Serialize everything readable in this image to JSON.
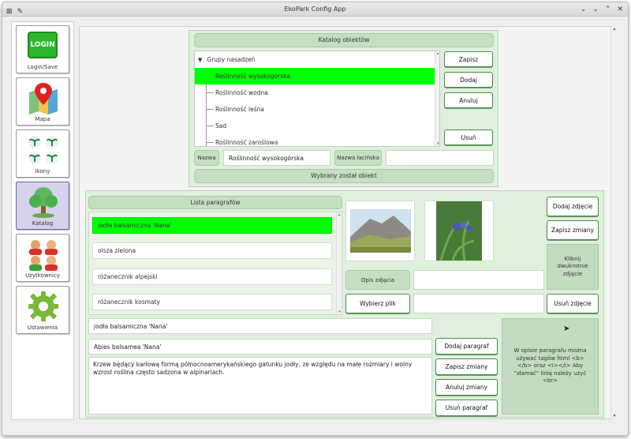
{
  "window": {
    "title": "EkoPark Config App"
  },
  "sidebar": {
    "items": [
      {
        "label": "Login/Save",
        "icon": "login-icon",
        "logo_text": "LOGIN"
      },
      {
        "label": "Mapa",
        "icon": "map-pin-icon"
      },
      {
        "label": "Ikony",
        "icon": "plant-icons-icon"
      },
      {
        "label": "Katalog",
        "icon": "tree-icon"
      },
      {
        "label": "Użytkownicy",
        "icon": "users-icon"
      },
      {
        "label": "Ustawienia",
        "icon": "gear-icon"
      }
    ],
    "active": "Katalog"
  },
  "catalog": {
    "title": "Katalog obiektów",
    "tree": {
      "root": "Grupy nasadzeń",
      "children": [
        "Roślinność wysokogórska",
        "Roślinność wodna",
        "Roślinność leśna",
        "Sad",
        "Roślinność zaroślowa"
      ],
      "selected": "Roślinność wysokogórska"
    },
    "buttons": {
      "save": "Zapisz",
      "add": "Dodaj",
      "cancel": "Anuluj",
      "delete": "Usuń"
    },
    "name_label": "Nazwa",
    "name_value": "Roślinność wysokogórska",
    "latin_label": "Nazwa łacińska",
    "latin_value": "",
    "status": "Wybrany został obiekt"
  },
  "paragraphs": {
    "title": "Lista paragrafów",
    "items": [
      "jodła balsamiczna 'Nana'",
      "olsza zielona",
      "różanecznik alpejski",
      "różanecznik kosmaty"
    ],
    "selected": "jodła balsamiczna 'Nana'",
    "photo_desc_label": "Opis zdjęcia",
    "photo_desc_value": "",
    "choose_file": "Wybierz plik",
    "file_path": "",
    "photo_buttons": {
      "add_photo": "Dodaj zdjęcie",
      "save_changes": "Zapisz zmiany",
      "delete_photo": "Usuń zdjęcie"
    },
    "dblclick_hint": "Kliknij dwukrotnie zdjęcie",
    "name_value": "jodła balsamiczna 'Nana'",
    "latin_value": "Abies balsamea 'Nana'",
    "description": "Krzew będący karłową formą północnoamerykańskiego gatunku jodły, ze względu na małe rozmiary i wolny wzrost roślina często sadzona w alpinariach.",
    "para_buttons": {
      "add": "Dodaj paragraf",
      "save": "Zapisz zmiany",
      "cancel": "Anuluj zmiany",
      "delete": "Usuń paragraf"
    },
    "html_hint": "W opisie paragrafu można używać tagów html <b></b> oraz <i></i> Aby \"złamać\" linię należy użyć <br>"
  },
  "colors": {
    "selected_green": "#00ff00",
    "panel_green": "#dff0dc",
    "header_green": "#c6dfc3",
    "button_border": "#4a8a4a",
    "active_nav": "#d6d2ec"
  }
}
